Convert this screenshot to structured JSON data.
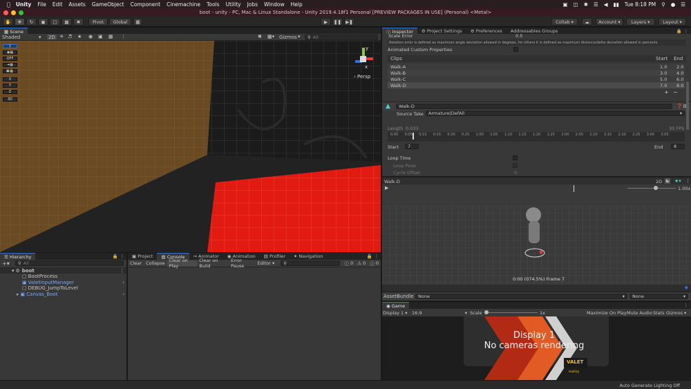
{
  "mac_menu": {
    "app": "Unity",
    "items": [
      "File",
      "Edit",
      "Assets",
      "GameObject",
      "Component",
      "Cinemachine",
      "Tools",
      "Utility",
      "Jobs",
      "Window",
      "Help"
    ],
    "clock": "Tue 8:18 PM"
  },
  "window": {
    "title": "boot - unity - PC, Mac & Linux Standalone - Unity 2019.4.18f1 Personal [PREVIEW PACKAGES IN USE] (Personal) <Metal>"
  },
  "toolbar": {
    "pivot": "Pivot",
    "global": "Global",
    "collab": "Collab",
    "account": "Account",
    "layers": "Layers",
    "layout": "Layout"
  },
  "scene": {
    "tab": "Scene",
    "shading": "Shaded",
    "mode_2d": "2D",
    "gizmos": "Gizmos",
    "search_all": "All",
    "persp": "Persp",
    "side_buttons": [
      "1",
      "OFF",
      "X",
      "Y",
      "Z",
      "3D"
    ],
    "axis_y": "y",
    "axis_x": "x"
  },
  "inspector": {
    "tabs": [
      "Inspector",
      "Project Settings",
      "Preferences",
      "Addressables Groups"
    ],
    "scale_error_label": "Scale Error",
    "scale_error_value": "0.5",
    "rotation_note": "Rotation error is defined as maximum angle deviation allowed in degrees, for others it is defined as maximum distance/delta deviation allowed in percents",
    "animated_custom": "Animated Custom Properties",
    "clips_header": "Clips",
    "start_header": "Start",
    "end_header": "End",
    "clips": [
      {
        "name": "Walk-A",
        "start": "1.0",
        "end": "2.0"
      },
      {
        "name": "Walk-B",
        "start": "3.0",
        "end": "4.0"
      },
      {
        "name": "Walk-C",
        "start": "5.0",
        "end": "6.0"
      },
      {
        "name": "Walk-D",
        "start": "7.0",
        "end": "8.0"
      }
    ],
    "clip_name": "Walk-D",
    "source_take_label": "Source Take",
    "source_take_value": "Armature|DefAll",
    "length_label": "Length",
    "length_value": "0.033",
    "fps": "30 FPS",
    "timeline_ticks": [
      "0:00",
      "0:05",
      "0:10",
      "0:15",
      "0:20",
      "0:25",
      "1:00",
      "1:05",
      "1:10",
      "1:15",
      "1:20",
      "1:25",
      "2:00",
      "2:05",
      "2:10",
      "2:15",
      "2:20",
      "2:25",
      "3:00",
      "3:05"
    ],
    "start_label": "Start",
    "start_value": "7",
    "end_label": "End",
    "end_value": "8",
    "loop_time": "Loop Time",
    "loop_pose": "Loop Pose",
    "cycle_offset": "Cycle Offset",
    "cycle_offset_value": "0"
  },
  "preview": {
    "name": "Walk-D",
    "mode_2d": "2D",
    "speed": "1.00x",
    "frame_text": "0:00 (074.5%) Frame 7"
  },
  "assetbundle": {
    "label": "AssetBundle",
    "name": "None",
    "variant": "None"
  },
  "game": {
    "tab": "Game",
    "display": "Display 1",
    "aspect": "16:9",
    "scale_label": "Scale",
    "scale_value": "1x",
    "maximize": "Maximize On Play",
    "mute": "Mute Audio",
    "stats": "Stats",
    "gizmos": "Gizmos",
    "overlay_line1": "Display 1",
    "overlay_line2": "No cameras rendering",
    "logo_top": "VALET",
    "logo_sub": "loading"
  },
  "hierarchy": {
    "tab": "Hierarchy",
    "search": "All",
    "scene_name": "boot",
    "items": [
      "BootProcess",
      "ValetInputManager",
      "DEBUG_JumpToLevel",
      "Canvas_Boot"
    ]
  },
  "console": {
    "tabs": [
      "Project",
      "Console",
      "Animator",
      "Animation",
      "Profiler",
      "Navigation"
    ],
    "buttons": [
      "Clear",
      "Collapse",
      "Clear on Play",
      "Clear on Build",
      "Error Pause",
      "Editor"
    ],
    "counts": [
      "0",
      "0",
      "0"
    ]
  },
  "status": {
    "text": "Auto Generate Lighting Off"
  },
  "colors": {
    "accent": "#2f72d8",
    "red_floor": "#e11a12",
    "orange_wall": "#6a4a22"
  }
}
